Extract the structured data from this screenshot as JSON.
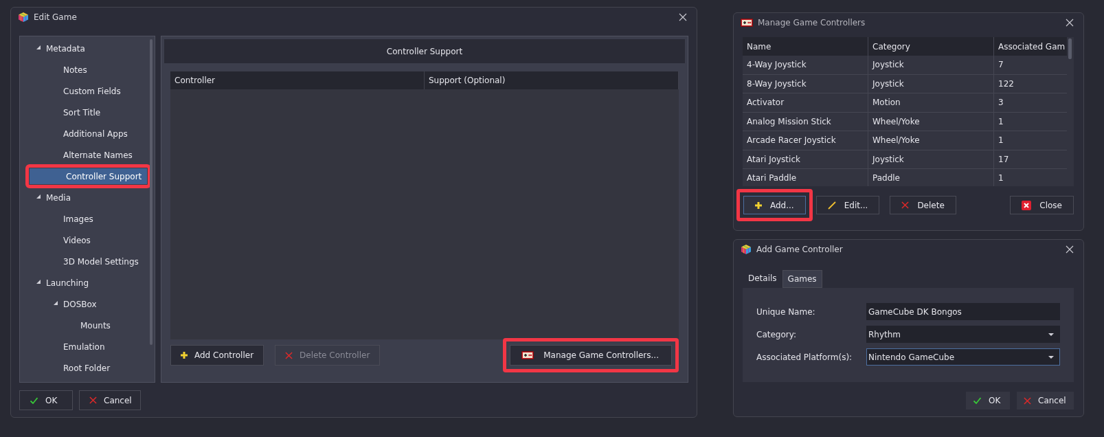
{
  "edit_game": {
    "title": "Edit Game",
    "tree": [
      {
        "label": "Metadata",
        "expanded": true,
        "selected": false,
        "highlighted": false,
        "children": [
          {
            "label": "Notes",
            "selected": false,
            "highlighted": false
          },
          {
            "label": "Custom Fields",
            "selected": false,
            "highlighted": false
          },
          {
            "label": "Sort Title",
            "selected": false,
            "highlighted": false
          },
          {
            "label": "Additional Apps",
            "selected": false,
            "highlighted": false
          },
          {
            "label": "Alternate Names",
            "selected": false,
            "highlighted": false
          },
          {
            "label": "Controller Support",
            "selected": true,
            "highlighted": true
          }
        ]
      },
      {
        "label": "Media",
        "expanded": true,
        "selected": false,
        "highlighted": false,
        "children": [
          {
            "label": "Images",
            "selected": false,
            "highlighted": false
          },
          {
            "label": "Videos",
            "selected": false,
            "highlighted": false
          },
          {
            "label": "3D Model Settings",
            "selected": false,
            "highlighted": false
          }
        ]
      },
      {
        "label": "Launching",
        "expanded": true,
        "selected": false,
        "highlighted": false,
        "children": [
          {
            "label": "DOSBox",
            "expanded": true,
            "selected": false,
            "highlighted": false,
            "children": [
              {
                "label": "Mounts",
                "selected": false,
                "highlighted": false
              }
            ]
          },
          {
            "label": "Emulation",
            "selected": false,
            "highlighted": false
          },
          {
            "label": "Root Folder",
            "selected": false,
            "highlighted": false
          }
        ]
      }
    ],
    "panel_title": "Controller Support",
    "table": {
      "columns": [
        "Controller",
        "Support (Optional)"
      ]
    },
    "buttons": [
      {
        "label": "Add Controller",
        "kind": "add",
        "disabled": false,
        "highlighted": false
      },
      {
        "label": "Delete Controller",
        "kind": "delete",
        "disabled": true,
        "highlighted": false
      },
      {
        "label": "Manage Game Controllers...",
        "kind": "controller",
        "disabled": false,
        "highlighted": true
      }
    ],
    "dialog_buttons": [
      {
        "label": "OK",
        "kind": "ok"
      },
      {
        "label": "Cancel",
        "kind": "cancel"
      }
    ]
  },
  "manage_controllers": {
    "title": "Manage Game Controllers",
    "table": {
      "columns": [
        "Name",
        "Category",
        "Associated Gam"
      ],
      "rows": [
        [
          "4-Way Joystick",
          "Joystick",
          "7"
        ],
        [
          "8-Way Joystick",
          "Joystick",
          "122"
        ],
        [
          "Activator",
          "Motion",
          "3"
        ],
        [
          "Analog Mission Stick",
          "Wheel/Yoke",
          "1"
        ],
        [
          "Arcade Racer Joystick",
          "Wheel/Yoke",
          "1"
        ],
        [
          "Atari Joystick",
          "Joystick",
          "17"
        ],
        [
          "Atari Paddle",
          "Paddle",
          "1"
        ]
      ]
    },
    "buttons": [
      {
        "label": "Add...",
        "kind": "add",
        "highlighted": true
      },
      {
        "label": "Edit...",
        "kind": "edit",
        "highlighted": false
      },
      {
        "label": "Delete",
        "kind": "delete",
        "highlighted": false
      }
    ],
    "close_button": {
      "label": "Close"
    }
  },
  "add_controller": {
    "title": "Add Game Controller",
    "tabs": [
      {
        "label": "Details",
        "selected": true
      },
      {
        "label": "Games",
        "selected": false
      }
    ],
    "fields": [
      {
        "label": "Unique Name:",
        "value": "GameCube DK Bongos",
        "kind": "text",
        "focused": false
      },
      {
        "label": "Category:",
        "value": "Rhythm",
        "kind": "dropdown",
        "focused": false
      },
      {
        "label": "Associated Platform(s):",
        "value": "Nintendo GameCube",
        "kind": "dropdown",
        "focused": true
      }
    ],
    "buttons": [
      {
        "label": "OK",
        "kind": "ok"
      },
      {
        "label": "Cancel",
        "kind": "cancel"
      }
    ]
  }
}
